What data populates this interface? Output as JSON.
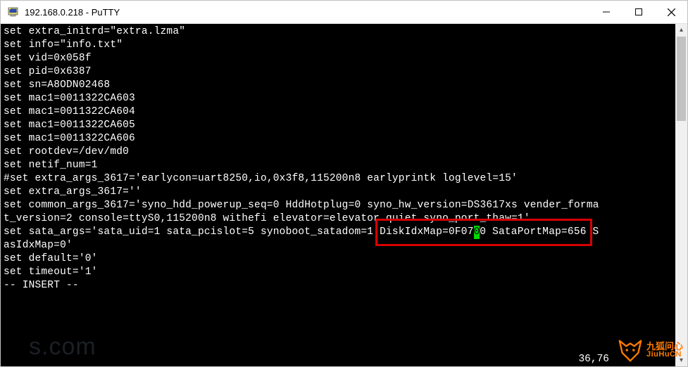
{
  "window": {
    "title": "192.168.0.218 - PuTTY"
  },
  "terminal": {
    "lines": [
      "set extra_initrd=\"extra.lzma\"",
      "set info=\"info.txt\"",
      "",
      "set vid=0x058f",
      "set pid=0x6387",
      "set sn=A8ODN02468",
      "set mac1=0011322CA603",
      "set mac1=0011322CA604",
      "set mac1=0011322CA605",
      "set mac1=0011322CA606",
      "set rootdev=/dev/md0",
      "set netif_num=1",
      "#set extra_args_3617='earlycon=uart8250,io,0x3f8,115200n8 earlyprintk loglevel=15'",
      "set extra_args_3617=''",
      "",
      "set common_args_3617='syno_hdd_powerup_seq=0 HddHotplug=0 syno_hw_version=DS3617xs vender_forma",
      "t_version=2 console=ttyS0,115200n8 withefi elevator=elevator quiet syno_port_thaw=1'",
      "",
      "set sata_args='sata_uid=1 sata_pcislot=5 synoboot_satadom=1 DiskIdxMap=0F0700 SataPortMap=656 S",
      "asIdxMap=0'",
      "",
      "set default='0'",
      "set timeout='1'",
      "-- INSERT --"
    ],
    "cursor_line_index": 18,
    "cursor_before": "set sata_args='sata_uid=1 sata_pcislot=5 synoboot_satadom=1 DiskIdxMap=0F07",
    "cursor_char": "0",
    "cursor_after": "0 SataPortMap=656 S",
    "status_right": "36,76          "
  },
  "highlight": {
    "text_span": "DiskIdxMap=0F0700 SataPortMap=656"
  },
  "watermarks": {
    "left": "s.com",
    "right_cn": "九狐问心",
    "right_en": "JiuHuCN"
  }
}
